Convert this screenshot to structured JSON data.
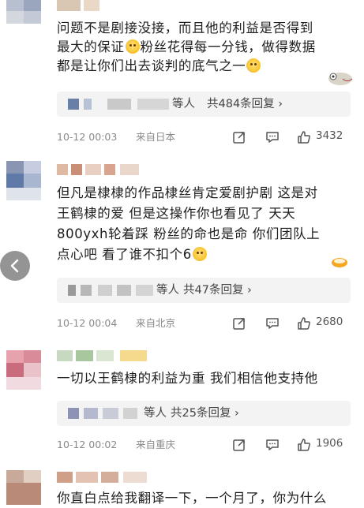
{
  "comments": [
    {
      "text_lines": [
        "问题不是剧接没接，而且他的利益是否得到",
        "最大的保证",
        "粉丝花得每一分钱，做得数据",
        "都是让你们出去谈判的底气之一"
      ],
      "replies": {
        "suffix": "等人",
        "count_text": "共484条回复 ›"
      },
      "time": "10-12 00:03",
      "location": "来自日本",
      "likes": "3432"
    },
    {
      "text_lines": [
        "但凡是棣棣的作品棣丝肯定爱剧护剧 这是对",
        "王鹤棣的爱 但是这操作你也看见了 天天",
        "800yxh轮着踩 粉丝的命也是命 你们团队上",
        "点心吧 看了谁不扣个6"
      ],
      "replies": {
        "suffix": "等人",
        "count_text": "共47条回复 ›"
      },
      "time": "10-12 00:04",
      "location": "来自北京",
      "likes": "2680"
    },
    {
      "text_lines": [
        "一切以王鹤棣的利益为重 我们相信他支持他"
      ],
      "replies": {
        "suffix": "等人",
        "count_text": "共25条回复 ›"
      },
      "time": "10-12 00:02",
      "location": "来自重庆",
      "likes": "1906"
    },
    {
      "text_lines": [
        "你直白点给我翻译一下，一个月了，你为什么"
      ]
    }
  ],
  "icons": {
    "repost": "share-icon",
    "comment": "comment-icon",
    "like": "thumbs-up-icon",
    "back": "chevron-left-icon"
  },
  "colors": {
    "reply_bg": "#f3f3f3",
    "meta_text": "#8a8a8a"
  }
}
